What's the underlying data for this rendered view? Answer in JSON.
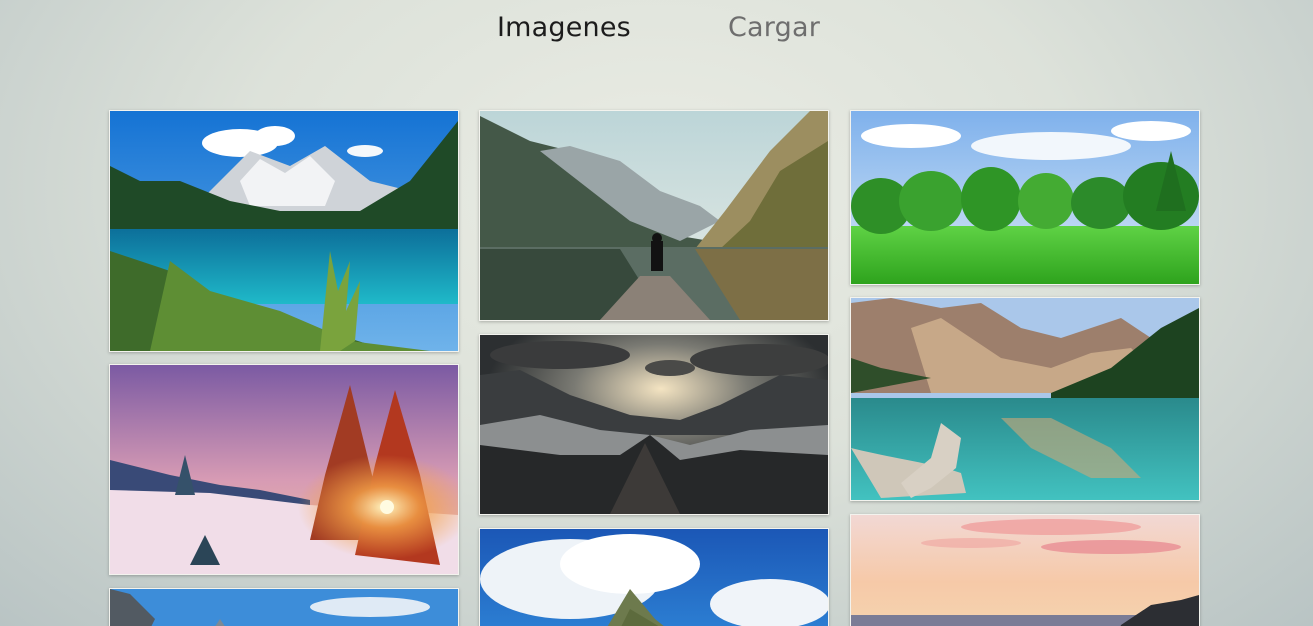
{
  "nav": {
    "tabs": [
      {
        "label": "Imagenes",
        "active": true
      },
      {
        "label": "Cargar",
        "active": false
      }
    ]
  },
  "gallery": {
    "images": [
      {
        "name": "mountain-lake-turquoise"
      },
      {
        "name": "lake-pier-person-sitting"
      },
      {
        "name": "green-meadow-trees"
      },
      {
        "name": "winter-sunset-pines"
      },
      {
        "name": "dark-mountain-sunrays"
      },
      {
        "name": "mountain-lake-driftwood"
      },
      {
        "name": "mountain-peak-alps"
      },
      {
        "name": "island-clouds-sky"
      },
      {
        "name": "pink-sunset-sea"
      }
    ]
  },
  "colors": {
    "active_tab": "#1c1c1c",
    "inactive_tab": "#6e6e6e"
  }
}
